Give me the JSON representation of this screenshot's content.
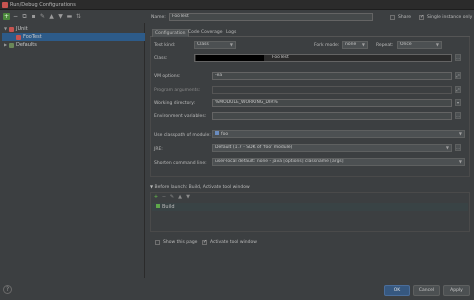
{
  "window": {
    "title": "Run/Debug Configurations"
  },
  "toolbar": {
    "add": "+",
    "remove": "−"
  },
  "tree": {
    "junit_label": "JUnit",
    "selected_label": "FooTest",
    "defaults_label": "Defaults"
  },
  "header": {
    "name_label": "Name:",
    "name_value": "FooTest",
    "share_label": "Share",
    "single_instance_label": "Single instance only",
    "single_instance_checked": true
  },
  "tabs": [
    "Configuration",
    "Code Coverage",
    "Logs"
  ],
  "config": {
    "test_kind_label": "Test kind:",
    "test_kind_value": "Class",
    "fork_mode_label": "Fork mode:",
    "fork_mode_value": "none",
    "repeat_label": "Repeat:",
    "repeat_value": "Once",
    "class_label": "Class:",
    "class_value": "FooTest",
    "vm_options_label": "VM options:",
    "vm_options_value": "-ea",
    "program_args_label": "Program arguments:",
    "working_dir_label": "Working directory:",
    "working_dir_value": "%MODULE_WORKING_DIR%",
    "env_vars_label": "Environment variables:",
    "classpath_label": "Use classpath of module:",
    "classpath_value": "foo",
    "jre_label": "JRE:",
    "jre_value": "Default (1.7 - SDK of 'foo' module)",
    "shorten_label": "Shorten command line:",
    "shorten_value": "user-local default: none - java [options] classname [args]"
  },
  "before_launch": {
    "title": "Before launch: Build, Activate tool window",
    "items": [
      "Build"
    ],
    "show_page_label": "Show this page",
    "show_page_checked": false,
    "activate_label": "Activate tool window",
    "activate_checked": true
  },
  "buttons": {
    "ok": "OK",
    "cancel": "Cancel",
    "apply": "Apply",
    "help": "?"
  }
}
